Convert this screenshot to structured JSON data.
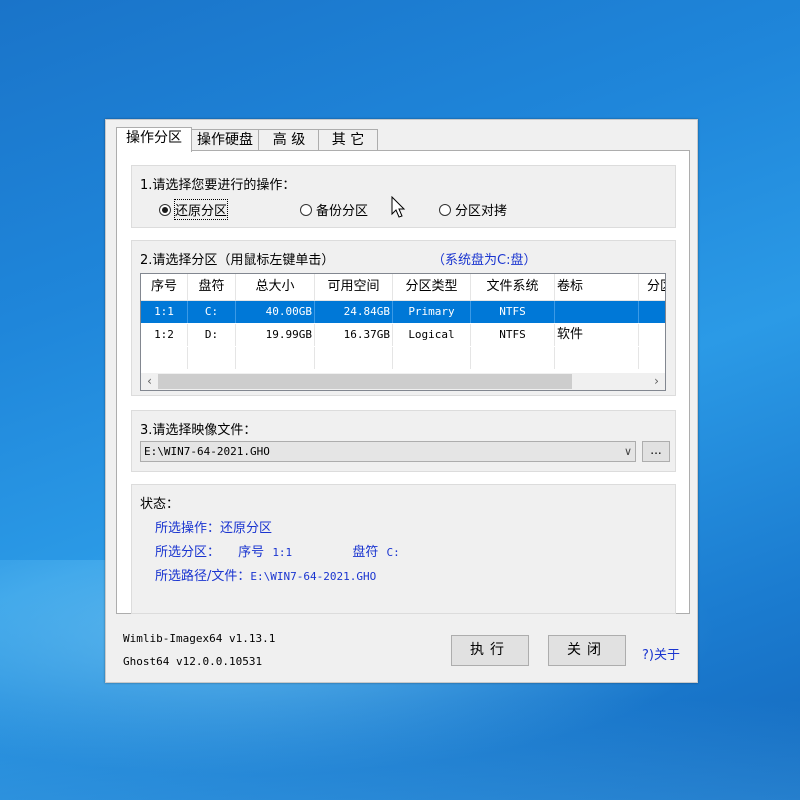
{
  "tabs": [
    "操作分区",
    "操作硬盘",
    "高 级",
    "其 它"
  ],
  "operation": {
    "title": "1.请选择您要进行的操作：",
    "options": [
      "还原分区",
      "备份分区",
      "分区对拷"
    ],
    "selected": "还原分区"
  },
  "partition": {
    "title": "2.请选择分区（用鼠标左键单击）",
    "system_note": "（系统盘为C:盘）",
    "columns": [
      "序号",
      "盘符",
      "总大小",
      "可用空间",
      "分区类型",
      "文件系统",
      "卷标",
      "分区"
    ],
    "rows": [
      [
        "1:1",
        "C:",
        "40.00GB",
        "24.84GB",
        "Primary",
        "NTFS",
        ""
      ],
      [
        "1:2",
        "D:",
        "19.99GB",
        "16.37GB",
        "Logical",
        "NTFS",
        "软件"
      ]
    ],
    "selected_row": 0
  },
  "image": {
    "title": "3.请选择映像文件：",
    "path": "E:\\WIN7-64-2021.GHO",
    "browse_label": "..."
  },
  "status": {
    "title": "状态：",
    "op_label": "所选操作：",
    "op_value": "还原分区",
    "part_label": "所选分区：",
    "part_seq_label": "序号",
    "part_seq_value": "1:1",
    "part_drive_label": "盘符",
    "part_drive_value": "C:",
    "path_label": "所选路径/文件：",
    "path_value": "E:\\WIN7-64-2021.GHO"
  },
  "footer": {
    "version1": "Wimlib-Imagex64 v1.13.1",
    "version2": "Ghost64 v12.0.0.10531",
    "execute_label": "执行",
    "close_label": "关闭",
    "about_label": "?)关于"
  },
  "colors": {
    "selection": "#0078d7",
    "status_text": "#1a35d0",
    "note_text": "#1a35d0"
  },
  "icons": [
    "mouse-cursor-icon",
    "chevron-left-icon",
    "chevron-right-icon",
    "chevron-down-icon"
  ]
}
